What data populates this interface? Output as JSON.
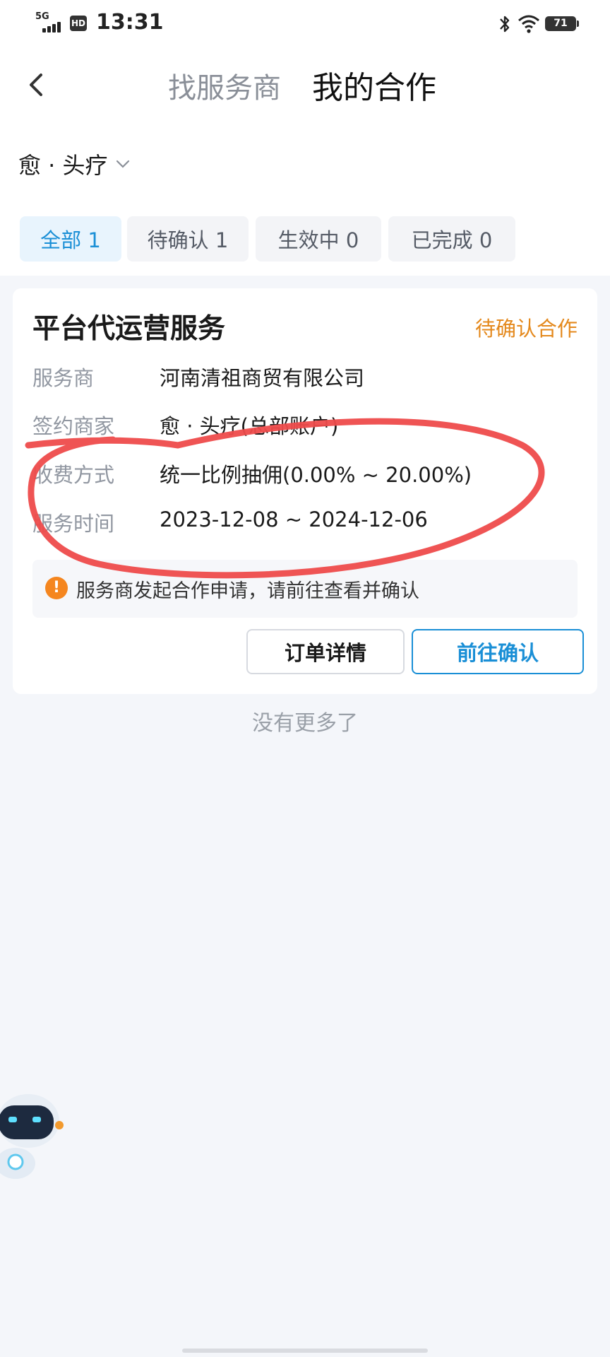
{
  "status_bar": {
    "network": "5G",
    "hd_badge": "HD",
    "time": "13:31",
    "battery": "71"
  },
  "nav": {
    "tab_find": "找服务商",
    "tab_mine": "我的合作"
  },
  "store": {
    "name": "愈 · 头疗"
  },
  "filters": [
    {
      "label": "全部 1",
      "active": true
    },
    {
      "label": "待确认 1",
      "active": false
    },
    {
      "label": "生效中 0",
      "active": false
    },
    {
      "label": "已完成 0",
      "active": false
    }
  ],
  "card": {
    "title": "平台代运营服务",
    "status": "待确认合作",
    "rows": [
      {
        "label": "服务商",
        "value": "河南清祖商贸有限公司"
      },
      {
        "label": "签约商家",
        "value": "愈 · 头疗(总部账户)"
      },
      {
        "label": "收费方式",
        "value": "统一比例抽佣(0.00% ~ 20.00%)"
      },
      {
        "label": "服务时间",
        "value": "2023-12-08 ~ 2024-12-06"
      }
    ],
    "notice": "服务商发起合作申请，请前往查看并确认",
    "btn_detail": "订单详情",
    "btn_confirm": "前往确认"
  },
  "footer": {
    "no_more": "没有更多了"
  },
  "colors": {
    "accent_blue": "#1a8fd6",
    "status_orange": "#e4891d",
    "annotation_red": "#ee4b4b"
  }
}
